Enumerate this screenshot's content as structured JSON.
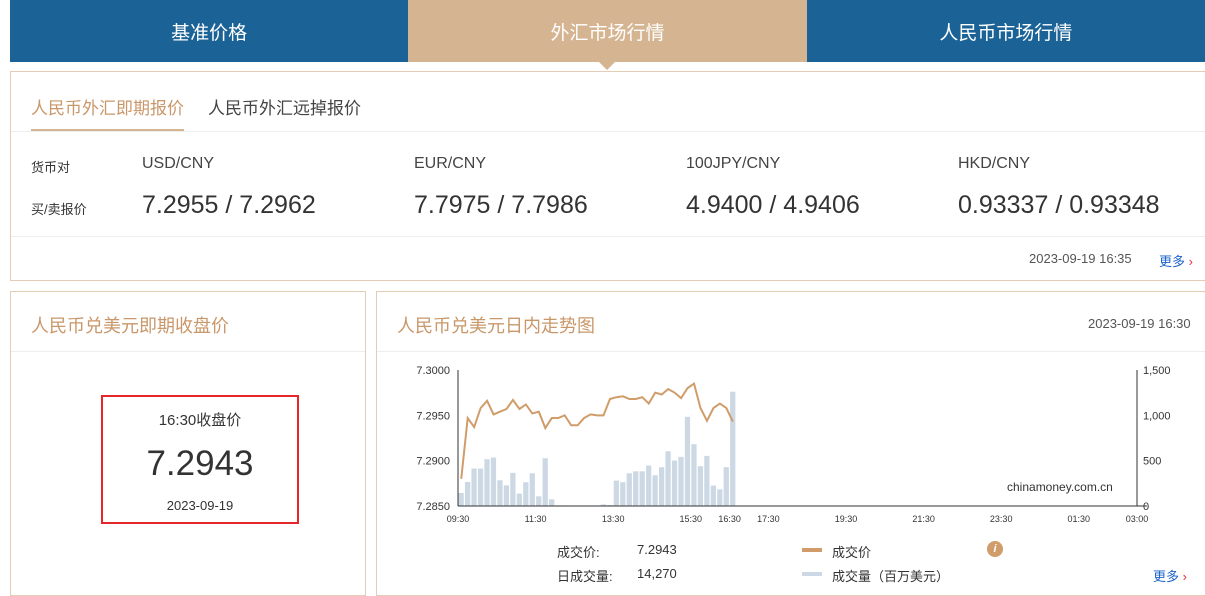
{
  "nav": {
    "tabs": [
      "基准价格",
      "外汇市场行情",
      "人民币市场行情"
    ],
    "active": 1
  },
  "spot": {
    "tabs": [
      "人民币外汇即期报价",
      "人民币外汇远掉报价"
    ],
    "pair_label": "货币对",
    "quote_label": "买/卖报价",
    "pairs": [
      {
        "pair": "USD/CNY",
        "quote": "7.2955 / 7.2962"
      },
      {
        "pair": "EUR/CNY",
        "quote": "7.7975 / 7.7986"
      },
      {
        "pair": "100JPY/CNY",
        "quote": "4.9400 / 4.9406"
      },
      {
        "pair": "HKD/CNY",
        "quote": "0.93337 / 0.93348"
      }
    ],
    "timestamp": "2023-09-19 16:35",
    "more": "更多"
  },
  "close": {
    "title": "人民币兑美元即期收盘价",
    "label": "16:30收盘价",
    "value": "7.2943",
    "date": "2023-09-19"
  },
  "intraday": {
    "title": "人民币兑美元日内走势图",
    "timestamp": "2023-09-19 16:30",
    "watermark": "chinamoney.com.cn",
    "price_label": "成交价:",
    "price": "7.2943",
    "volume_label": "日成交量:",
    "volume": "14,270",
    "legend_price": "成交价",
    "legend_volume": "成交量（百万美元）",
    "more": "更多"
  },
  "colors": {
    "navy": "#1b6397",
    "tan": "#d5b491",
    "line": "#d09c6a",
    "bar": "#ccd9e4"
  },
  "chart_data": {
    "type": "line+bar",
    "x_ticks": [
      "09:30",
      "11:30",
      "13:30",
      "15:30",
      "16:30",
      "17:30",
      "19:30",
      "21:30",
      "23:30",
      "01:30",
      "03:00"
    ],
    "y_left": {
      "ticks": [
        "7.3000",
        "7.2950",
        "7.2900",
        "7.2850"
      ],
      "range": [
        7.285,
        7.3
      ]
    },
    "y_right": {
      "ticks": [
        "1,500",
        "1,000",
        "500",
        "0"
      ],
      "range": [
        0,
        1500
      ]
    },
    "series": [
      {
        "name": "成交价",
        "values": [
          7.288,
          7.2947,
          7.2937,
          7.2958,
          7.2966,
          7.2951,
          7.2954,
          7.2957,
          7.2967,
          7.2957,
          7.2962,
          7.2952,
          7.2954,
          7.2936,
          7.2947,
          7.2947,
          7.295,
          7.2939,
          7.2939,
          7.2947,
          7.2951,
          7.295,
          7.295,
          7.2968,
          7.297,
          7.2971,
          7.2968,
          7.2968,
          7.297,
          7.2963,
          7.2975,
          7.2973,
          7.2979,
          7.2975,
          7.2969,
          7.298,
          7.2985,
          7.2958,
          7.2944,
          7.2958,
          7.2963,
          7.2958,
          7.2943
        ]
      },
      {
        "name": "成交量（百万美元）",
        "values": [
          144,
          265,
          413,
          413,
          516,
          534,
          284,
          228,
          365,
          136,
          262,
          361,
          107,
          527,
          74,
          7,
          7,
          0,
          2,
          3,
          2,
          3,
          18,
          11,
          280,
          262,
          361,
          383,
          383,
          446,
          339,
          428,
          604,
          501,
          542,
          984,
          682,
          439,
          553,
          225,
          184,
          428,
          1260
        ]
      }
    ]
  }
}
